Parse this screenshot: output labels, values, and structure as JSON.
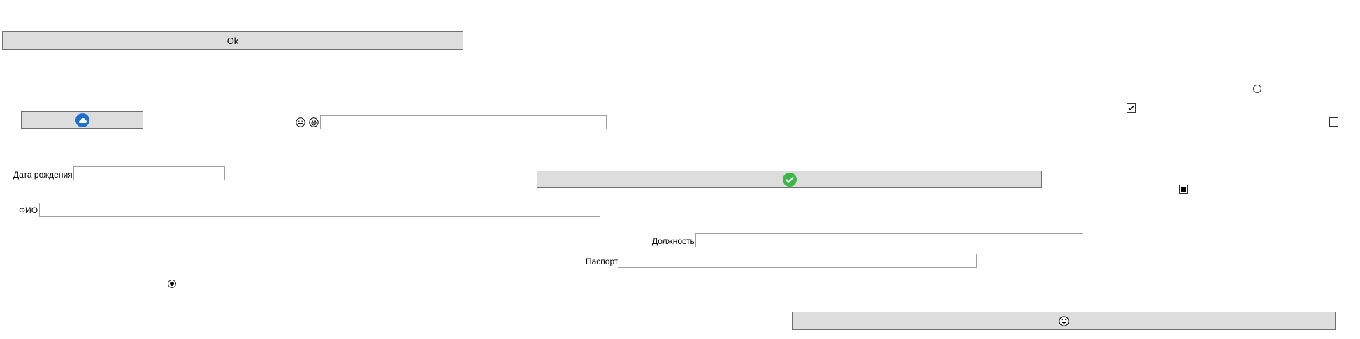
{
  "buttons": {
    "ok_label": "Ok",
    "cloud_icon": "blue-cloud-icon",
    "confirm_icon": "green-check-icon",
    "emoji_icon": "laughing-emoji-icon"
  },
  "emoji_row": {
    "first_icon": "laughing-emoji-icon",
    "second_icon": "grinning-emoji-icon",
    "input_value": ""
  },
  "form": {
    "birth_date_label": "Дата рождения",
    "birth_date_value": "",
    "full_name_label": "ФИО",
    "full_name_value": "",
    "position_label": "Должность",
    "position_value": "",
    "passport_label": "Паспорт",
    "passport_value": ""
  },
  "controls": {
    "radio_top_right_checked": false,
    "radio_left_checked": true,
    "checkbox_a_checked": true,
    "checkbox_b_checked": false,
    "checkbox_c_state": "indeterminate"
  },
  "colors": {
    "button_bg": "#dddddd",
    "cloud_blue": "#1f6fd1",
    "check_green": "#3cb54a"
  }
}
